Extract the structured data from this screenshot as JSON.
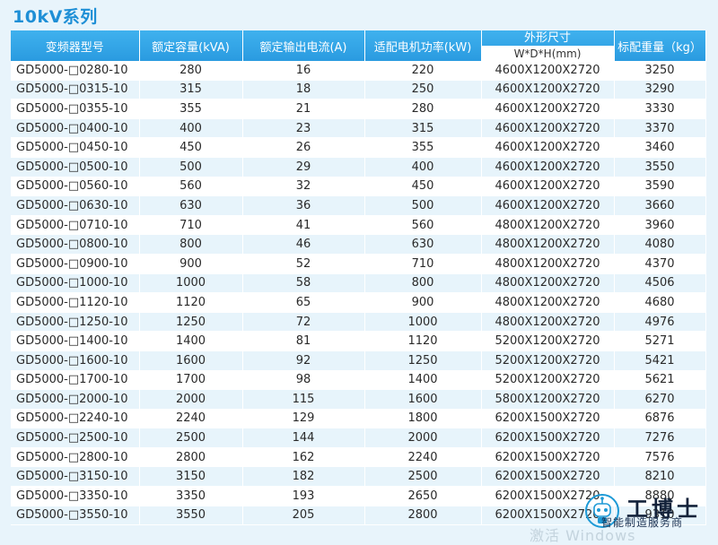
{
  "title": "10kV系列",
  "headers": {
    "model": "变频器型号",
    "capacity": "额定容量(kVA)",
    "current": "额定输出电流(A)",
    "power": "适配电机功率(kW)",
    "dim": "外形尺寸",
    "dim_unit": "W*D*H(mm)",
    "weight": "标配重量（kg）"
  },
  "rows": [
    [
      "GD5000-□0280-10",
      "280",
      "16",
      "220",
      "4600X1200X2720",
      "3250"
    ],
    [
      "GD5000-□0315-10",
      "315",
      "18",
      "250",
      "4600X1200X2720",
      "3290"
    ],
    [
      "GD5000-□0355-10",
      "355",
      "21",
      "280",
      "4600X1200X2720",
      "3330"
    ],
    [
      "GD5000-□0400-10",
      "400",
      "23",
      "315",
      "4600X1200X2720",
      "3370"
    ],
    [
      "GD5000-□0450-10",
      "450",
      "26",
      "355",
      "4600X1200X2720",
      "3460"
    ],
    [
      "GD5000-□0500-10",
      "500",
      "29",
      "400",
      "4600X1200X2720",
      "3550"
    ],
    [
      "GD5000-□0560-10",
      "560",
      "32",
      "450",
      "4600X1200X2720",
      "3590"
    ],
    [
      "GD5000-□0630-10",
      "630",
      "36",
      "500",
      "4600X1200X2720",
      "3660"
    ],
    [
      "GD5000-□0710-10",
      "710",
      "41",
      "560",
      "4800X1200X2720",
      "3960"
    ],
    [
      "GD5000-□0800-10",
      "800",
      "46",
      "630",
      "4800X1200X2720",
      "4080"
    ],
    [
      "GD5000-□0900-10",
      "900",
      "52",
      "710",
      "4800X1200X2720",
      "4370"
    ],
    [
      "GD5000-□1000-10",
      "1000",
      "58",
      "800",
      "4800X1200X2720",
      "4506"
    ],
    [
      "GD5000-□1120-10",
      "1120",
      "65",
      "900",
      "4800X1200X2720",
      "4680"
    ],
    [
      "GD5000-□1250-10",
      "1250",
      "72",
      "1000",
      "4800X1200X2720",
      "4976"
    ],
    [
      "GD5000-□1400-10",
      "1400",
      "81",
      "1120",
      "5200X1200X2720",
      "5271"
    ],
    [
      "GD5000-□1600-10",
      "1600",
      "92",
      "1250",
      "5200X1200X2720",
      "5421"
    ],
    [
      "GD5000-□1700-10",
      "1700",
      "98",
      "1400",
      "5200X1200X2720",
      "5621"
    ],
    [
      "GD5000-□2000-10",
      "2000",
      "115",
      "1600",
      "5800X1200X2720",
      "6270"
    ],
    [
      "GD5000-□2240-10",
      "2240",
      "129",
      "1800",
      "6200X1500X2720",
      "6876"
    ],
    [
      "GD5000-□2500-10",
      "2500",
      "144",
      "2000",
      "6200X1500X2720",
      "7276"
    ],
    [
      "GD5000-□2800-10",
      "2800",
      "162",
      "2240",
      "6200X1500X2720",
      "7576"
    ],
    [
      "GD5000-□3150-10",
      "3150",
      "182",
      "2500",
      "6200X1500X2720",
      "8210"
    ],
    [
      "GD5000-□3350-10",
      "3350",
      "193",
      "2650",
      "6200X1500X2720",
      "8880"
    ],
    [
      "GD5000-□3550-10",
      "3550",
      "205",
      "2800",
      "6200X1500X2720",
      "9310"
    ]
  ],
  "watermark": {
    "text": "激活 Windows",
    "logo_name": "工博士",
    "logo_sub": "智能制造服务商",
    "logo_color": "#1e9ad6"
  }
}
